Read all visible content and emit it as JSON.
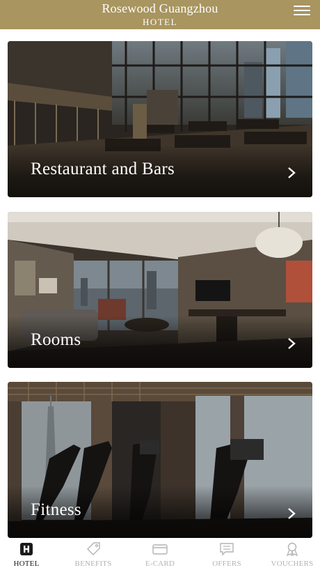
{
  "header": {
    "title": "Rosewood Guangzhou",
    "subtitle": "HOTEL",
    "menu_icon": "hamburger-menu-icon",
    "background_color": "#a8955f"
  },
  "cards": [
    {
      "label": "Restaurant and Bars",
      "icon": "chevron-right-icon"
    },
    {
      "label": "Rooms",
      "icon": "chevron-right-icon"
    },
    {
      "label": "Fitness",
      "icon": "chevron-right-icon"
    }
  ],
  "tabbar": {
    "active_color": "#1a1a1a",
    "inactive_color": "#b3b3b3",
    "items": [
      {
        "label": "HOTEL",
        "icon": "hotel-h-icon",
        "active": true
      },
      {
        "label": "BENEFITS",
        "icon": "tag-icon",
        "active": false
      },
      {
        "label": "E-CARD",
        "icon": "card-icon",
        "active": false
      },
      {
        "label": "OFFERS",
        "icon": "message-icon",
        "active": false
      },
      {
        "label": "VOUCHERS",
        "icon": "ribbon-icon",
        "active": false
      }
    ]
  }
}
